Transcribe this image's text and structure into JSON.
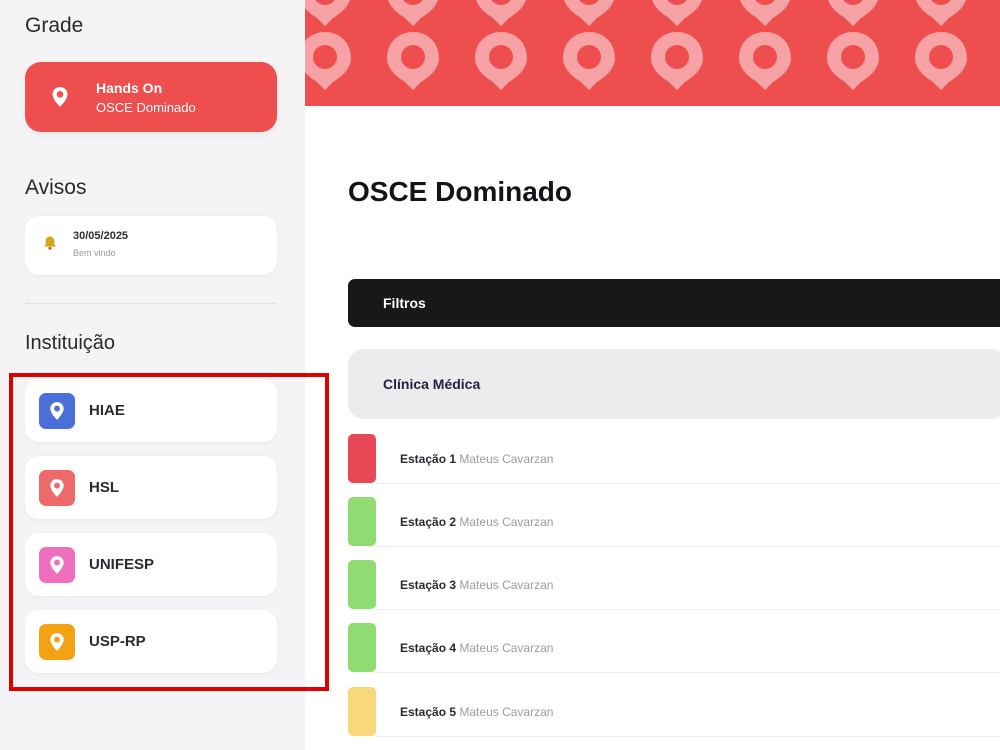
{
  "sidebar": {
    "grade_title": "Grade",
    "grade_card": {
      "title": "Hands On",
      "subtitle": "OSCE Dominado",
      "color": "#ee4e4e",
      "icon": "location-pin-icon"
    },
    "avisos_title": "Avisos",
    "aviso": {
      "date": "30/05/2025",
      "text": "Bem vindo",
      "icon": "bell-icon"
    },
    "instituicao_title": "Instituição",
    "institutions": [
      {
        "label": "HIAE",
        "color": "#4a6fd8",
        "icon": "location-pin-icon"
      },
      {
        "label": "HSL",
        "color": "#ee6a6a",
        "icon": "location-pin-icon"
      },
      {
        "label": "UNIFESP",
        "color": "#ef6fbd",
        "icon": "location-pin-icon"
      },
      {
        "label": "USP-RP",
        "color": "#f5a114",
        "icon": "location-pin-icon"
      }
    ]
  },
  "banner": {
    "color": "#ee4e4e",
    "pattern_icon": "location-pin-icon"
  },
  "main": {
    "title": "OSCE Dominado",
    "filters_label": "Filtros",
    "category_label": "Clínica Médica",
    "stations": [
      {
        "name": "Estação 1",
        "author": "Mateus Cavarzan",
        "color": "#e84855"
      },
      {
        "name": "Estação 2",
        "author": "Mateus Cavarzan",
        "color": "#8fdc72"
      },
      {
        "name": "Estação 3",
        "author": "Mateus Cavarzan",
        "color": "#8fdc72"
      },
      {
        "name": "Estação 4",
        "author": "Mateus Cavarzan",
        "color": "#8fdc72"
      },
      {
        "name": "Estação 5",
        "author": "Mateus Cavarzan",
        "color": "#f8d87a"
      }
    ]
  }
}
